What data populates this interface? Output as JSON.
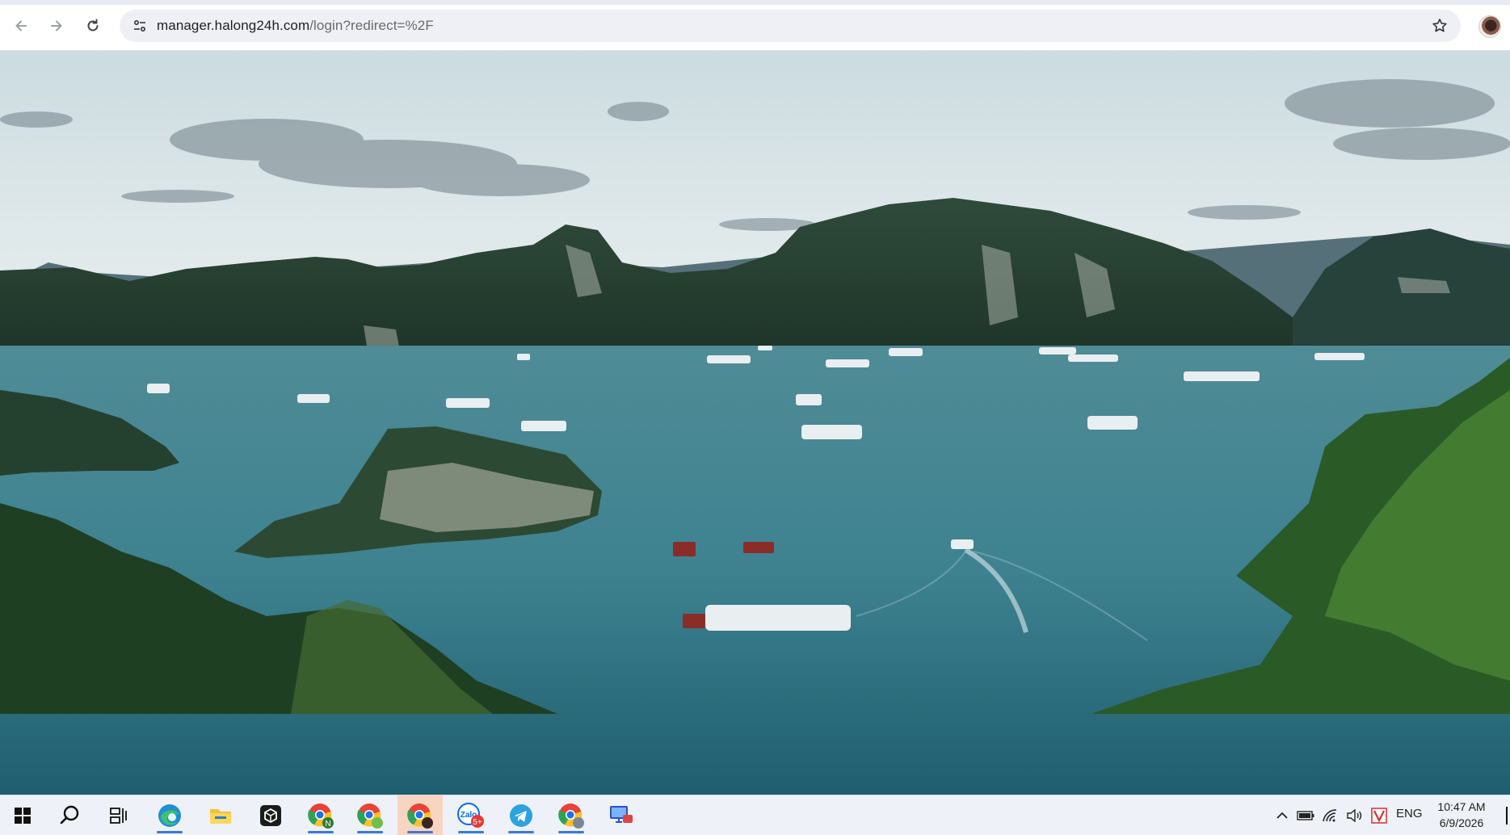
{
  "browser": {
    "url_host": "manager.halong24h.com",
    "url_path": "/login?redirect=%2F"
  },
  "page": {
    "background_image": "halong-bay-landscape"
  },
  "taskbar": {
    "apps": [
      {
        "name": "start-icon"
      },
      {
        "name": "search-icon"
      },
      {
        "name": "task-view-icon"
      },
      {
        "name": "edge-icon"
      },
      {
        "name": "file-explorer-icon"
      },
      {
        "name": "cube-app-icon"
      },
      {
        "name": "chrome-profile-n-icon"
      },
      {
        "name": "chrome-profile-2-icon"
      },
      {
        "name": "chrome-icon",
        "active": true
      },
      {
        "name": "zalo-icon",
        "badge": "5+"
      },
      {
        "name": "telegram-icon"
      },
      {
        "name": "chrome-profile-3-icon"
      },
      {
        "name": "remote-desktop-icon"
      }
    ],
    "tray": {
      "language": "ENG",
      "time": "10:47 AM",
      "date": "6/9/2026"
    },
    "accent_color": "#3b78d8"
  }
}
